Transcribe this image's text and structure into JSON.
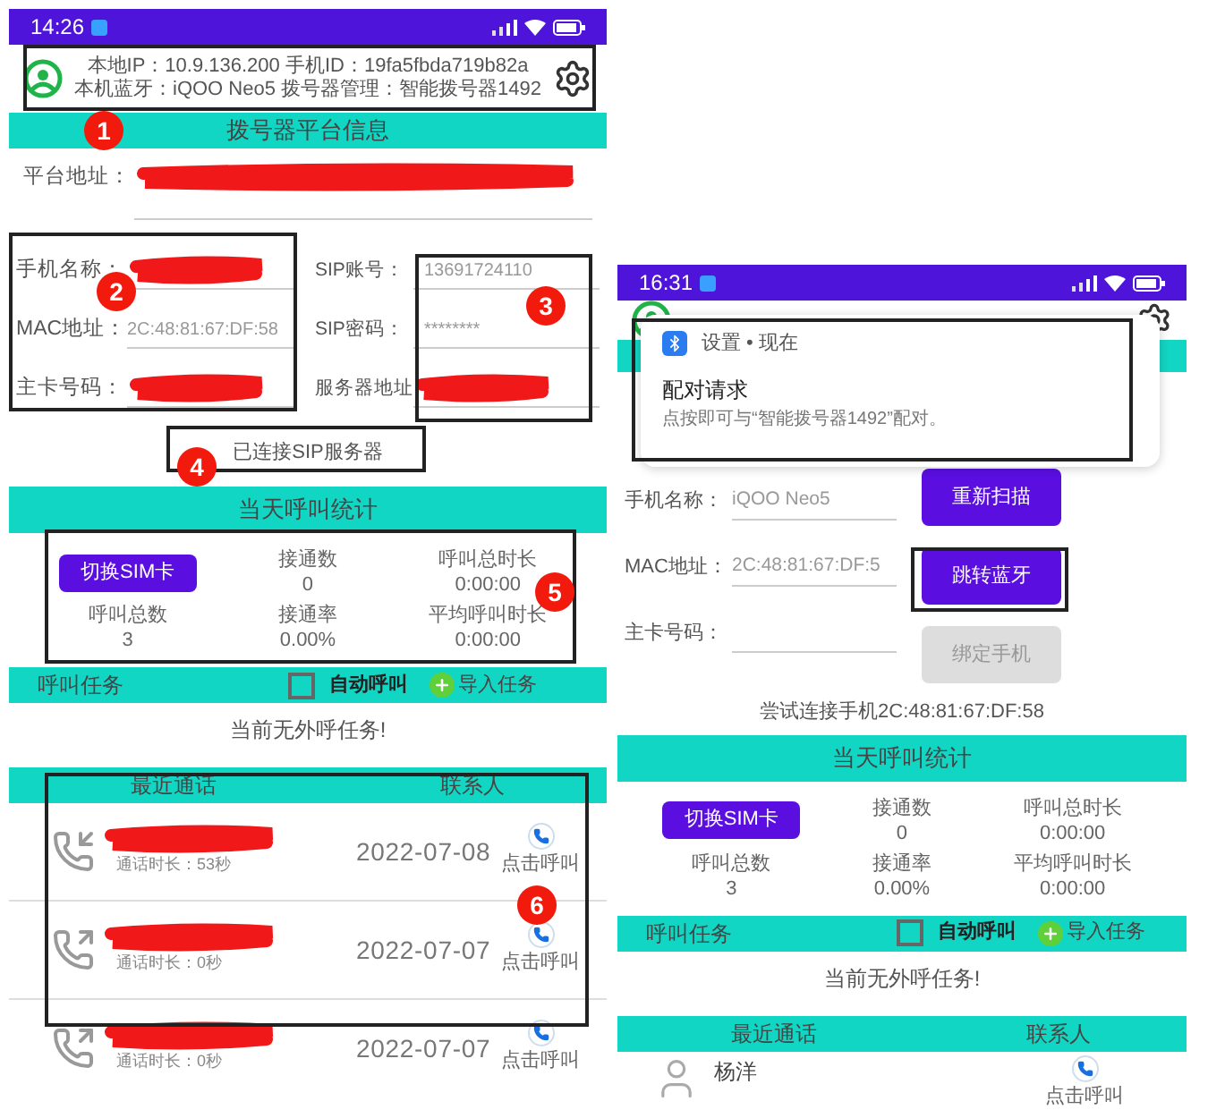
{
  "left_screen": {
    "status_bar": {
      "time": "14:26"
    },
    "header": {
      "line_1": "本地IP：10.9.136.200 手机ID：19fa5fbda719b82a",
      "line_2": "本机蓝牙：iQOO Neo5 拨号器管理：智能拨号器1492"
    },
    "section_title": "拨号器平台信息",
    "platform": {
      "label": "平台地址：",
      "redacted": true
    },
    "fields_left": [
      {
        "label": "手机名称：",
        "redacted": true
      },
      {
        "label": "MAC地址：",
        "value": "2C:48:81:67:DF:58",
        "redacted": false
      },
      {
        "label": "主卡号码：",
        "redacted": true
      }
    ],
    "fields_right": [
      {
        "label": "SIP账号：",
        "value": "13691724110",
        "redacted": false
      },
      {
        "label": "SIP密码：",
        "value": "********",
        "redacted": false
      },
      {
        "label": "服务器地址",
        "redacted": true
      }
    ],
    "connection_status": "已连接SIP服务器",
    "stats": {
      "title": "当天呼叫统计",
      "button": "切换SIM卡",
      "items": [
        {
          "label": "接通数",
          "value": "0"
        },
        {
          "label": "呼叫总时长",
          "value": "0:00:00"
        },
        {
          "label": "呼叫总数",
          "value": "3"
        },
        {
          "label": "接通率",
          "value": "0.00%"
        },
        {
          "label": "平均呼叫时长",
          "value": "0:00:00"
        }
      ]
    },
    "tasks": {
      "title": "呼叫任务",
      "auto_call": {
        "label": "自动呼叫",
        "checked": false
      },
      "import": "导入任务",
      "empty": "当前无外呼任务!"
    },
    "recent": {
      "columns": [
        "最近通话",
        "联系人"
      ],
      "calls": [
        {
          "kind": "incoming",
          "duration": "通话时长：53秒",
          "date": "2022-07-08",
          "action": "点击呼叫"
        },
        {
          "kind": "outgoing",
          "duration": "通话时长：0秒",
          "date": "2022-07-07",
          "action": "点击呼叫"
        },
        {
          "kind": "outgoing",
          "duration": "通话时长：0秒",
          "date": "2022-07-07",
          "action": "点击呼叫"
        }
      ]
    },
    "annotations": [
      {
        "number": "1"
      },
      {
        "number": "2"
      },
      {
        "number": "3"
      },
      {
        "number": "4"
      },
      {
        "number": "5"
      },
      {
        "number": "6"
      }
    ]
  },
  "right_screen": {
    "status_bar": {
      "time": "16:31"
    },
    "notification": {
      "source": "设置 • 现在",
      "title": "配对请求",
      "body": "点按即可与“智能拨号器1492”配对。"
    },
    "fields": [
      {
        "label": "手机名称：",
        "value": "iQOO Neo5"
      },
      {
        "label": "MAC地址：",
        "value": "2C:48:81:67:DF:5"
      },
      {
        "label": "主卡号码："
      }
    ],
    "buttons": [
      {
        "label": "重新扫描",
        "disabled": false
      },
      {
        "label": "跳转蓝牙",
        "disabled": false
      },
      {
        "label": "绑定手机",
        "disabled": true
      }
    ],
    "connection_status": "尝试连接手机2C:48:81:67:DF:58",
    "stats": {
      "title": "当天呼叫统计",
      "button": "切换SIM卡",
      "items": [
        {
          "label": "接通数",
          "value": "0"
        },
        {
          "label": "呼叫总时长",
          "value": "0:00:00"
        },
        {
          "label": "呼叫总数",
          "value": "3"
        },
        {
          "label": "接通率",
          "value": "0.00%"
        },
        {
          "label": "平均呼叫时长",
          "value": "0:00:00"
        }
      ]
    },
    "tasks": {
      "title": "呼叫任务",
      "auto_call": {
        "label": "自动呼叫",
        "checked": false
      },
      "import": "导入任务",
      "empty": "当前无外呼任务!"
    },
    "recent": {
      "columns": [
        "最近通话",
        "联系人"
      ],
      "contacts": [
        {
          "name": "杨洋",
          "action": "点击呼叫"
        }
      ]
    }
  }
}
